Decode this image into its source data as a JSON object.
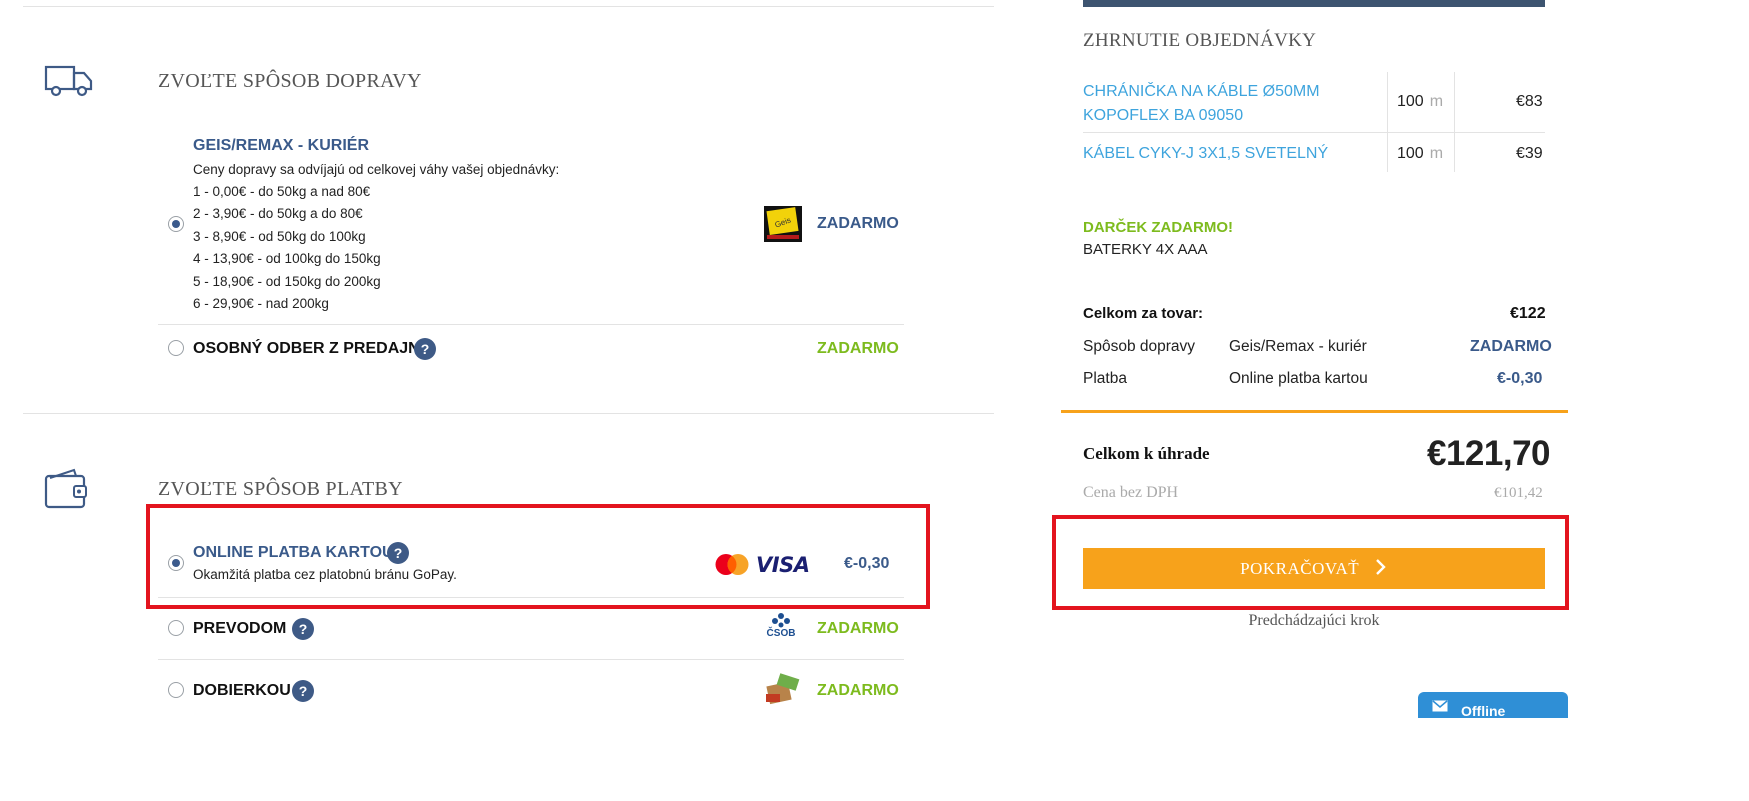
{
  "shipping": {
    "title": "ZVOĽTE SPÔSOB DOPRAVY",
    "options": [
      {
        "title": "GEIS/REMAX - KURIÉR",
        "description": "Ceny dopravy sa odvíjajú od celkovej váhy vašej objednávky:",
        "tiers": [
          "1 - 0,00€ - do 50kg a nad 80€",
          "2 - 3,90€ - do 50kg a do 80€",
          "3 - 8,90€ - od 50kg do 100kg",
          "4 - 13,90€ - od 100kg do 150kg",
          "5 - 18,90€ - od 150kg do 200kg",
          "6 - 29,90€ - nad 200kg"
        ],
        "price": "ZADARMO",
        "logo": "geis-logo",
        "selected": true
      },
      {
        "title": "OSOBNÝ ODBER Z PREDAJNE",
        "help": "?",
        "price": "ZADARMO",
        "selected": false
      }
    ]
  },
  "payment": {
    "title": "ZVOĽTE SPÔSOB PLATBY",
    "options": [
      {
        "title": "ONLINE PLATBA KARTOU",
        "help": "?",
        "description": "Okamžitá platba cez platobnú bránu GoPay.",
        "card_brand": "VISA",
        "price": "€-0,30",
        "selected": true
      },
      {
        "title": "PREVODOM",
        "help": "?",
        "logo_text": "ČSOB",
        "price": "ZADARMO",
        "selected": false
      },
      {
        "title": "DOBIERKOU",
        "help": "?",
        "logo": "cash-package-icon",
        "price": "ZADARMO",
        "selected": false
      }
    ]
  },
  "summary": {
    "title": "ZHRNUTIE OBJEDNÁVKY",
    "items": [
      {
        "name": "CHRÁNIČKA NA KÁBLE Ø50MM KOPOFLEX BA 09050",
        "qty": "100",
        "unit": "m",
        "price": "€83"
      },
      {
        "name": "KÁBEL CYKY-J 3X1,5 SVETELNÝ",
        "qty": "100",
        "unit": "m",
        "price": "€39"
      }
    ],
    "gift_label": "DARČEK ZADARMO!",
    "gift_item": "BATERKY 4X AAA",
    "goods_total_label": "Celkom za tovar:",
    "goods_total": "€122",
    "shipping_label": "Spôsob dopravy",
    "shipping_method": "Geis/Remax - kuriér",
    "shipping_price": "ZADARMO",
    "payment_label": "Platba",
    "payment_method": "Online platba kartou",
    "payment_price": "€-0,30",
    "total_label": "Celkom k úhrade",
    "total": "€121,70",
    "vat_label": "Cena bez DPH",
    "vat_total": "€101,42",
    "continue_label": "POKRAČOVAŤ",
    "back_label": "Predchádzajúci krok"
  },
  "chat": {
    "label": "Offline"
  },
  "colors": {
    "accent": "#f7a21b",
    "blue": "#3a5a8a",
    "green": "#7dbb1e",
    "link": "#3ea4dd",
    "highlight": "#e3141e"
  }
}
